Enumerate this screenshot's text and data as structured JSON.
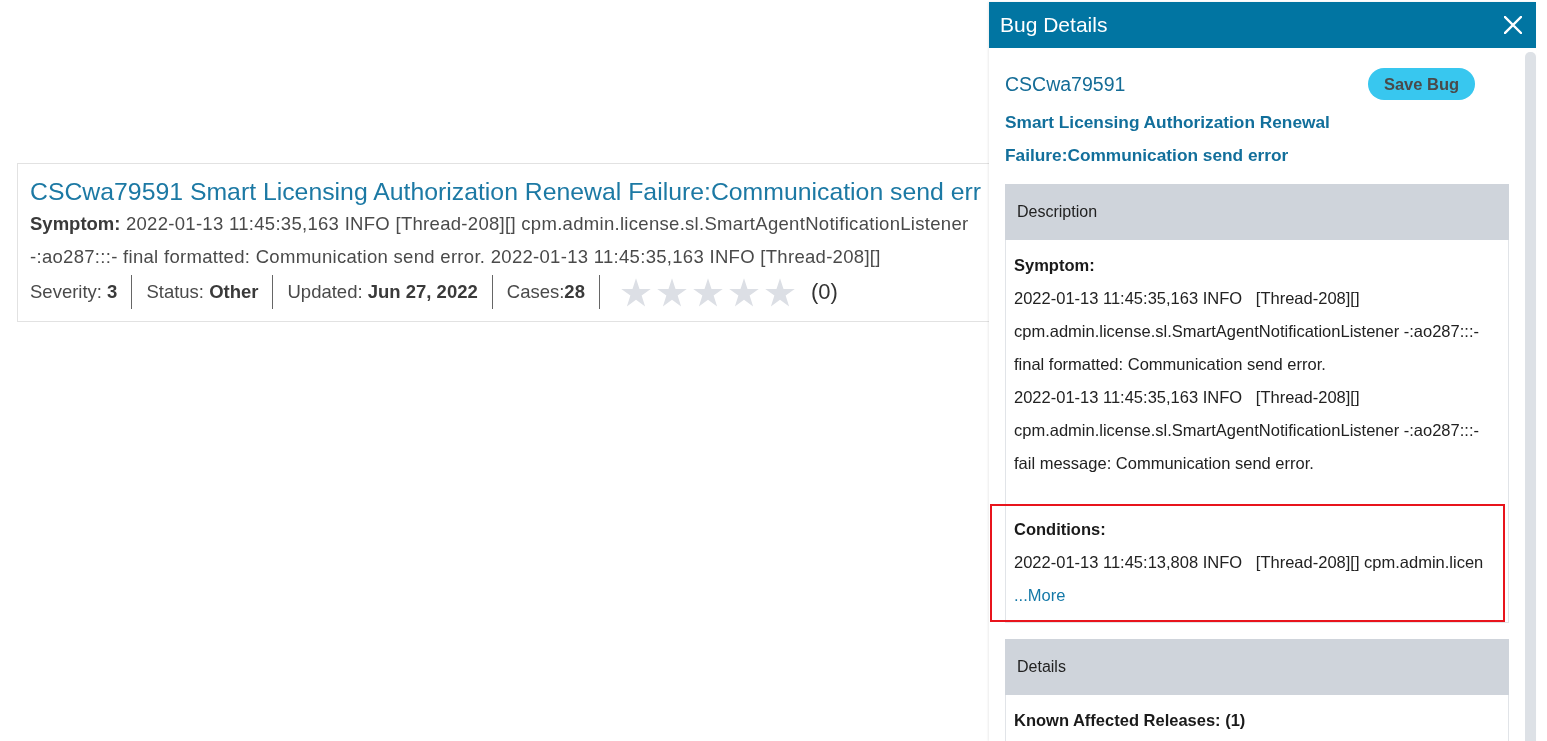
{
  "result_card": {
    "title": "CSCwa79591 Smart Licensing Authorization Renewal Failure:Communication send err",
    "snippet": "**Symptom:** 2022-01-13 11:45:35,163 INFO [Thread-208][] cpm.admin.license.sl.SmartAgentNotificationListener -:ao287:::- final formatted: Communication send error. 2022-01-13 11:45:35,163 INFO [Thread-208][]",
    "meta": [
      "Severity: **3**",
      "Status: **Other**",
      "Updated: **Jun 27, 2022**",
      "Cases:**28**"
    ],
    "rating": {
      "stars": 0,
      "count": "(0)"
    }
  },
  "panel": {
    "title": "Bug Details",
    "bug_id": "CSCwa79591",
    "save_button": "Save Bug",
    "headline": "Smart Licensing Authorization Renewal Failure:Communication send error",
    "sections": [
      {
        "title": "Description",
        "fields": [
          {
            "label": "Symptom:",
            "entries": [
              "2022-01-13 11:45:35,163 INFO   [Thread-208][] cpm.admin.license.sl.SmartAgentNotificationListener -:ao287:::- final formatted: Communication send error.",
              "2022-01-13 11:45:35,163 INFO   [Thread-208][] cpm.admin.license.sl.SmartAgentNotificationListener -:ao287:::- fail message: Communication send error."
            ],
            "highlighted": false
          },
          {
            "label": "Conditions:",
            "entries": [
              "2022-01-13 11:45:13,808 INFO   [Thread-208][] cpm.admin.licen"
            ],
            "more_link": "...More",
            "highlighted": true
          }
        ]
      },
      {
        "title": "Details",
        "fields": [
          {
            "label": "Known Affected Releases: (1)",
            "highlighted": false
          }
        ]
      }
    ]
  }
}
